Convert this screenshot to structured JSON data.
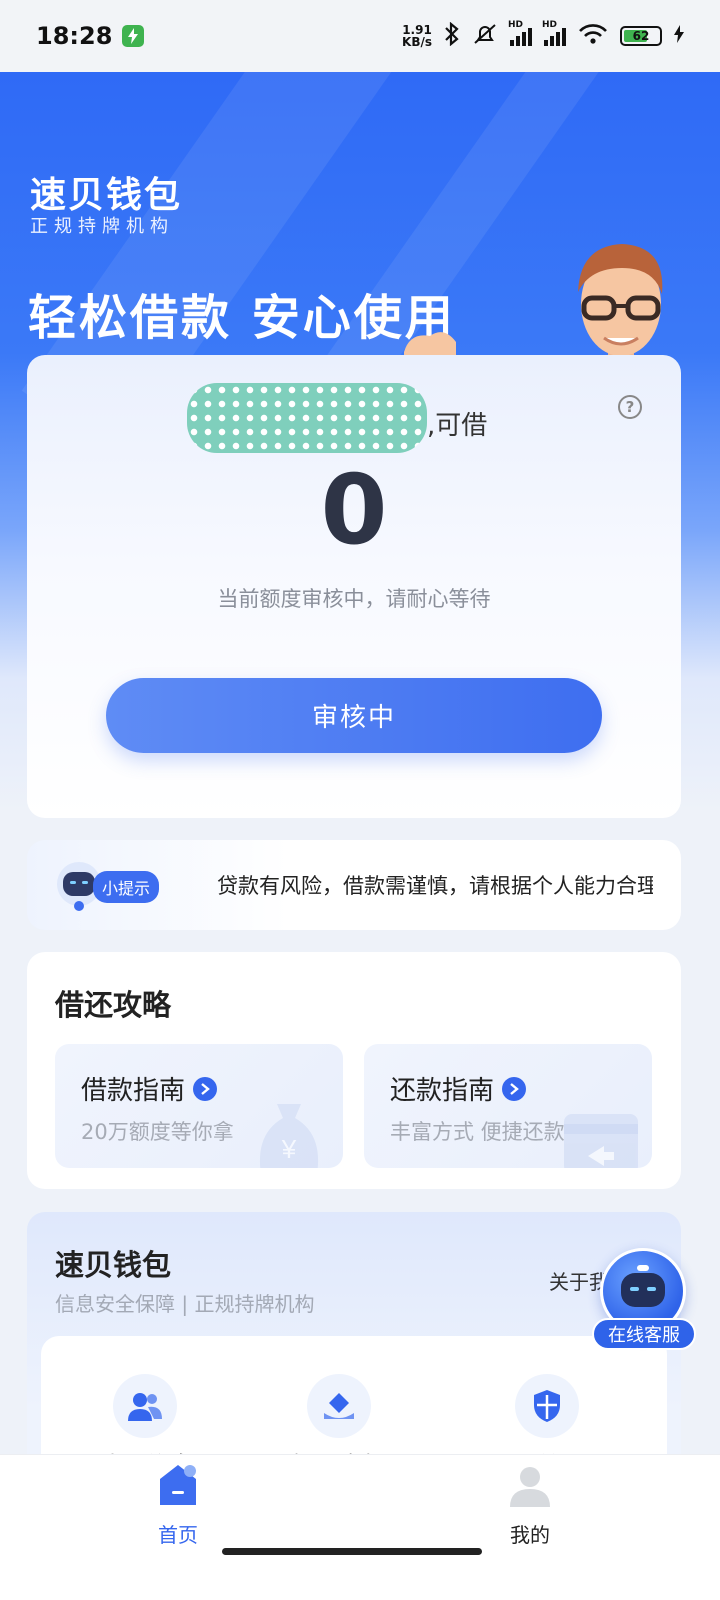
{
  "status_bar": {
    "time": "18:28",
    "net_speed_value": "1.91",
    "net_speed_unit": "KB/s",
    "battery": "62",
    "icons": [
      "charging-icon",
      "bluetooth-icon",
      "mute-icon",
      "signal-icon",
      "wifi-icon",
      "battery-icon"
    ]
  },
  "hero": {
    "brand_name": "速贝钱包",
    "brand_sub": "正规持牌机构",
    "slogan": "轻松借款  安心使用"
  },
  "credit_card": {
    "can_borrow_suffix": ",可借",
    "amount": "0",
    "note": "当前额度审核中，请耐心等待",
    "button_label": "审核中"
  },
  "tips": {
    "badge": "小提示",
    "text": "贷款有风险，借款需谨慎，请根据个人能力合理借款"
  },
  "guide": {
    "title": "借还攻略",
    "tiles": [
      {
        "title": "借款指南",
        "sub": "20万额度等你拿"
      },
      {
        "title": "还款指南",
        "sub": "丰富方式 便捷还款"
      }
    ]
  },
  "brand_card": {
    "title": "速贝钱包",
    "sub": "信息安全保障  |  正规持牌机构",
    "about": "关于我们",
    "features": [
      "填写信息",
      "极速审批",
      "灵活借还"
    ]
  },
  "service": {
    "label": "在线客服"
  },
  "bottom_nav": {
    "items": [
      {
        "label": "首页",
        "active": true
      },
      {
        "label": "我的",
        "active": false
      }
    ]
  },
  "colors": {
    "primary": "#3566ee",
    "hero": "#2f6af6",
    "text_muted": "#8a8f9a"
  }
}
